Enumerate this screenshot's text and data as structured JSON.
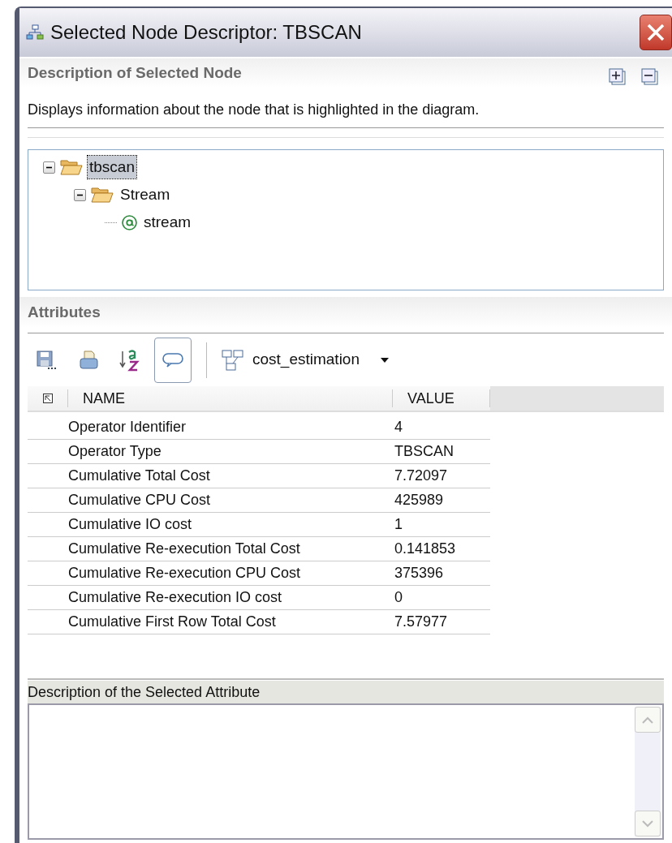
{
  "window": {
    "title": "Selected Node Descriptor: TBSCAN"
  },
  "node_panel": {
    "title": "Description of Selected Node",
    "description": "Displays information about the node that is highlighted in the diagram.",
    "tree": [
      {
        "label": "tbscan",
        "kind": "folder",
        "expanded": true,
        "selected": true,
        "children": [
          {
            "label": "Stream",
            "kind": "folder",
            "expanded": true,
            "selected": false,
            "children": [
              {
                "label": "stream",
                "kind": "attribute",
                "selected": false
              }
            ]
          }
        ]
      }
    ]
  },
  "attributes_panel": {
    "title": "Attributes",
    "toolbar": [
      {
        "kind": "save",
        "pressed": false
      },
      {
        "kind": "print",
        "pressed": false
      },
      {
        "kind": "sort",
        "pressed": false
      },
      {
        "kind": "comment",
        "pressed": true
      }
    ],
    "view_selector": {
      "value": "cost_estimation"
    },
    "table": {
      "columns": [
        "NAME",
        "VALUE"
      ],
      "rows": [
        {
          "name": "Operator Identifier",
          "value": "4"
        },
        {
          "name": "Operator Type",
          "value": "TBSCAN"
        },
        {
          "name": "Cumulative Total Cost",
          "value": "7.72097"
        },
        {
          "name": "Cumulative CPU Cost",
          "value": "425989"
        },
        {
          "name": "Cumulative IO cost",
          "value": "1"
        },
        {
          "name": "Cumulative Re-execution Total Cost",
          "value": "0.141853"
        },
        {
          "name": "Cumulative Re-execution CPU Cost",
          "value": "375396"
        },
        {
          "name": "Cumulative Re-execution IO cost",
          "value": "0"
        },
        {
          "name": "Cumulative First Row Total Cost",
          "value": "7.57977"
        }
      ]
    }
  },
  "attribute_description": {
    "title": "Description of the Selected Attribute"
  }
}
